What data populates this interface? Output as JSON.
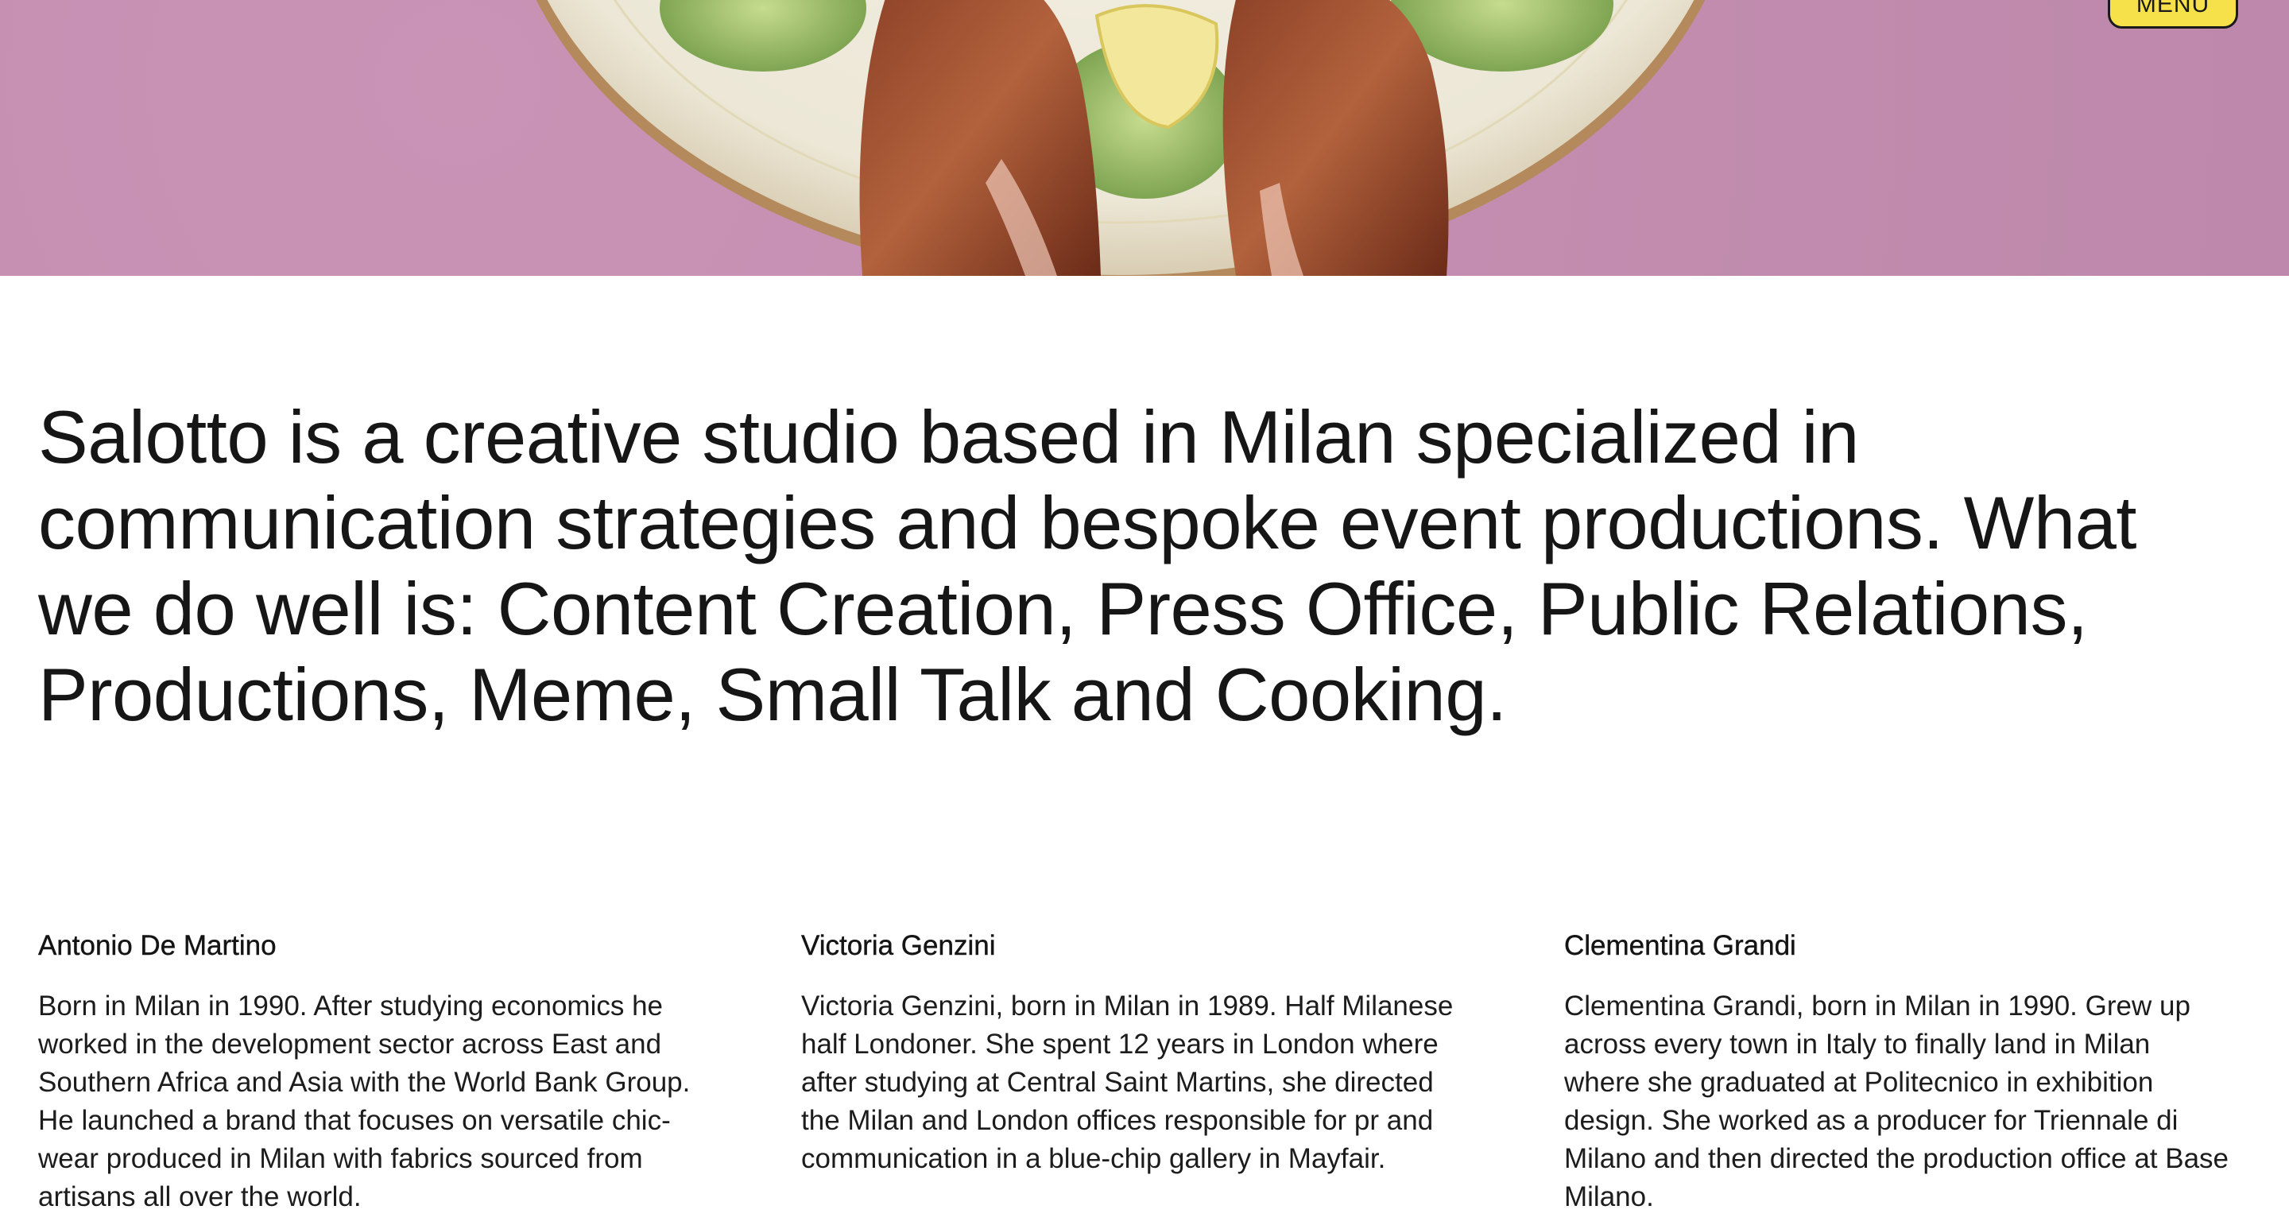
{
  "header": {
    "menu_label": "MENU"
  },
  "intro": {
    "text": "Salotto is a creative studio based in Milan specialized in communication strategies and bespoke event productions. What we do well is: Content Creation, Press Office, Public Relations, Productions, Meme, Small Talk and Cooking."
  },
  "team": [
    {
      "name": "Antonio De Martino",
      "bio": "Born in Milan in 1990. After studying economics he worked in the development sector across East and Southern Africa and Asia with the World Bank Group. He launched a brand that focuses on versatile chic-wear produced in Milan with fabrics sourced from artisans all over the world."
    },
    {
      "name": "Victoria Genzini",
      "bio": "Victoria Genzini, born in Milan in 1989. Half Milanese half Londoner. She spent 12 years in London where after studying at Central Saint Martins, she directed the Milan and London offices responsible for pr and communication in a blue-chip gallery in Mayfair."
    },
    {
      "name": "Clementina Grandi",
      "bio": "Clementina Grandi, born in Milan in 1990. Grew up across every town in Italy to finally land in Milan where she graduated at Politecnico in exhibition design. She worked as a producer for Triennale di Milano and then directed the production office at Base Milano."
    }
  ],
  "colors": {
    "hero_background": "#c48fb1",
    "menu_button": "#f6e14a",
    "text": "#161616"
  }
}
